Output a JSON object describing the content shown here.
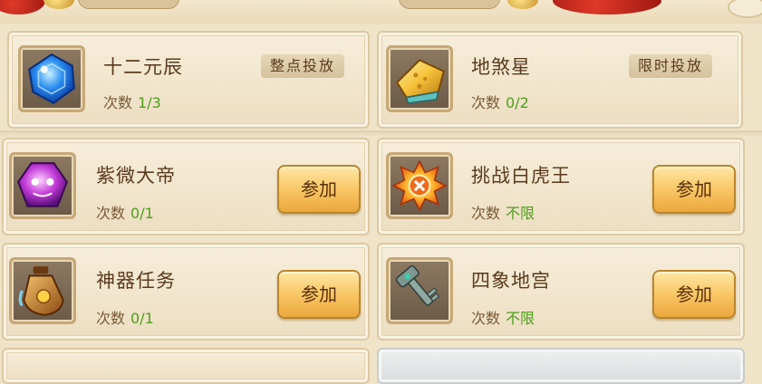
{
  "events": [
    {
      "id": "shier-yuanchen",
      "title": "十二元辰",
      "count_label": "次数",
      "count": "1/3",
      "tag": "整点投放",
      "icon": "blue-gem-icon"
    },
    {
      "id": "disha-xing",
      "title": "地煞星",
      "count_label": "次数",
      "count": "0/2",
      "tag": "限时投放",
      "icon": "gold-ingot-icon"
    },
    {
      "id": "ziwei-dadi",
      "title": "紫微大帝",
      "count_label": "次数",
      "count": "0/1",
      "button": "参加",
      "icon": "purple-gem-icon"
    },
    {
      "id": "baihu-wang",
      "title": "挑战白虎王",
      "count_label": "次数",
      "count": "不限",
      "button": "参加",
      "icon": "fire-orb-icon"
    },
    {
      "id": "shenqi-renwu",
      "title": "神器任务",
      "count_label": "次数",
      "count": "0/1",
      "button": "参加",
      "icon": "potion-jar-icon"
    },
    {
      "id": "sixiang-digong",
      "title": "四象地宫",
      "count_label": "次数",
      "count": "不限",
      "button": "参加",
      "icon": "key-icon"
    }
  ],
  "colors": {
    "count_value": "#4e9e1c",
    "title": "#5b3a1e",
    "card_bg": "#f7eedb",
    "button": "#f9c766"
  }
}
